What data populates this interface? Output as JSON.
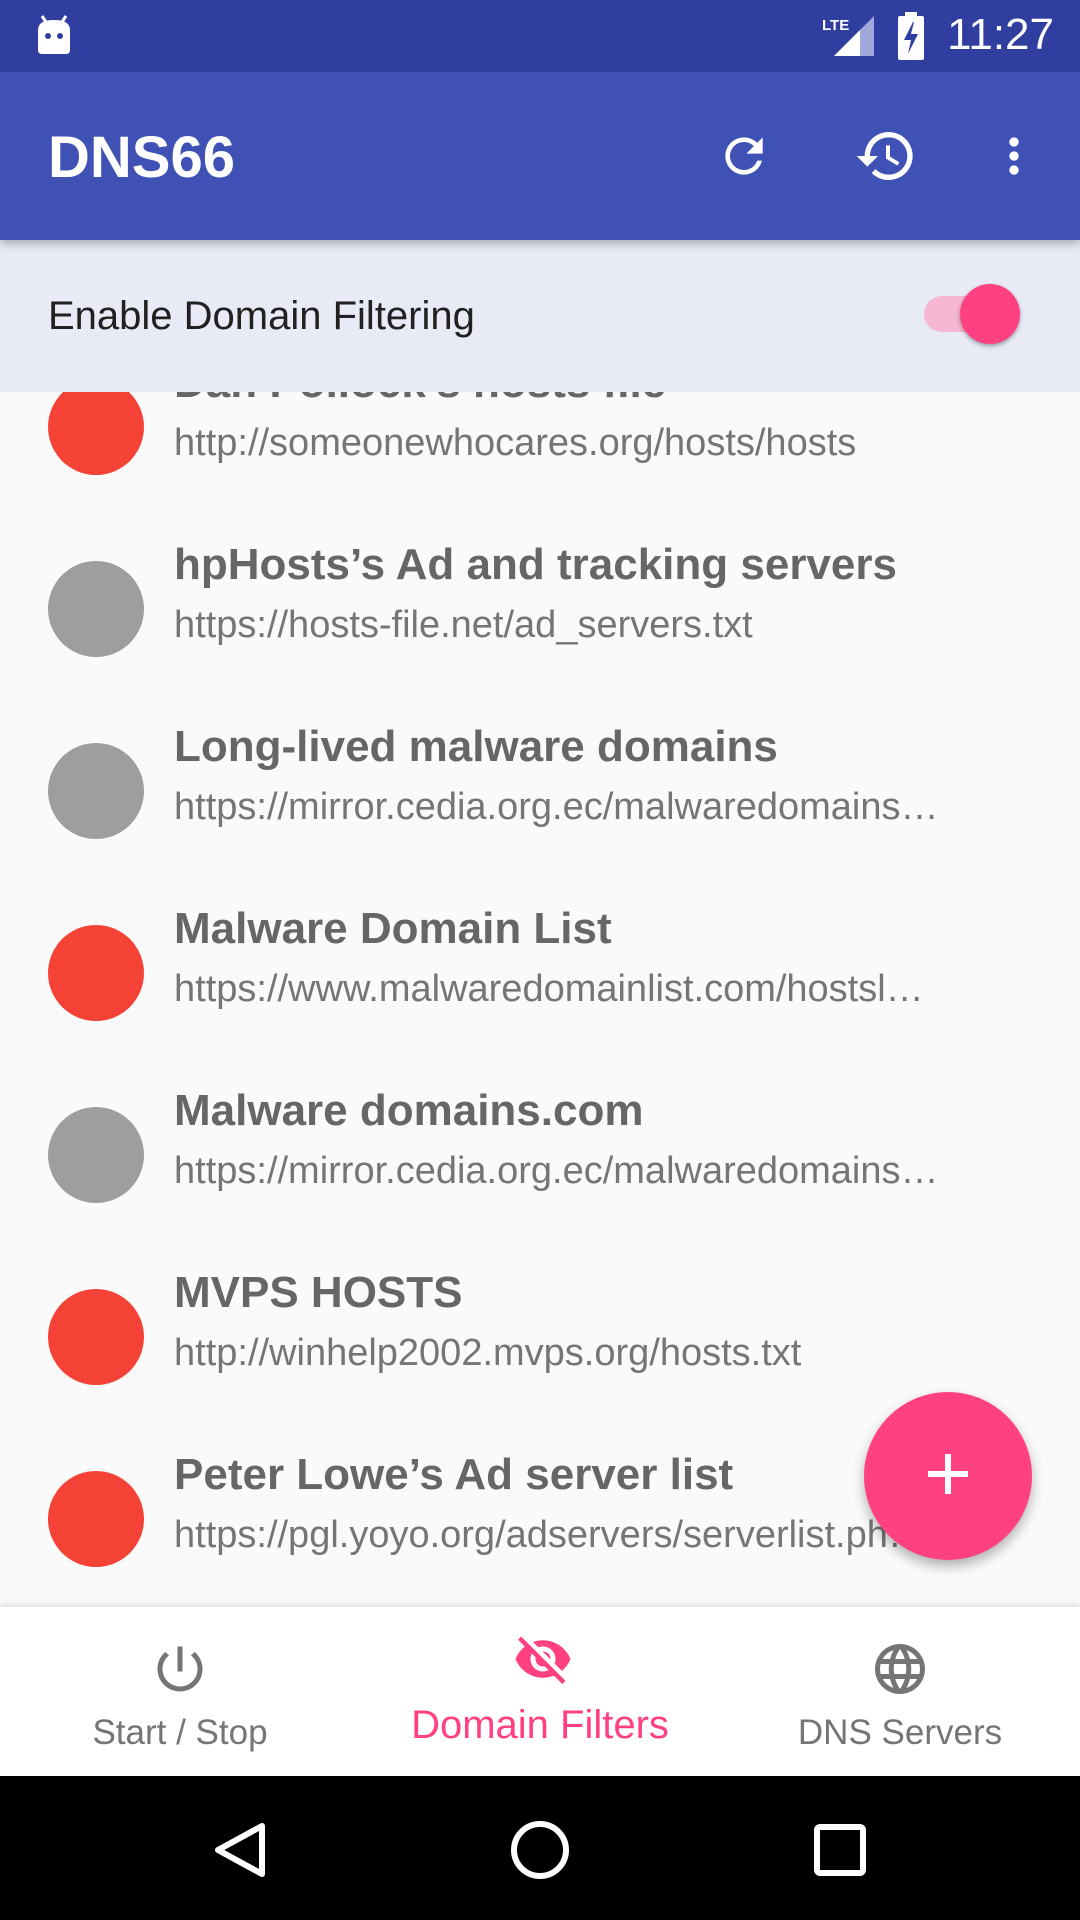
{
  "status_bar": {
    "time": "11:27",
    "network": "LTE"
  },
  "app_bar": {
    "title": "DNS66",
    "actions": [
      "refresh-icon",
      "history-icon",
      "more-vert-icon"
    ]
  },
  "filter_toggle": {
    "label": "Enable Domain Filtering",
    "enabled": true
  },
  "colors": {
    "primary": "#3f51b5",
    "primary_dark": "#303f9f",
    "accent": "#ff4081",
    "deny": "#f44336",
    "ignore": "#9e9e9e"
  },
  "host_lists": [
    {
      "name": "Dan Pollock's hosts file",
      "url": "http://someonewhocares.org/hosts/hosts",
      "state": "deny"
    },
    {
      "name": "hpHosts’s Ad and tracking servers",
      "url": "https://hosts-file.net/ad_servers.txt",
      "state": "ignore"
    },
    {
      "name": "Long-lived malware domains",
      "url": "https://mirror.cedia.org.ec/malwaredomains…",
      "state": "ignore"
    },
    {
      "name": "Malware Domain List",
      "url": "https://www.malwaredomainlist.com/hostsl…",
      "state": "deny"
    },
    {
      "name": "Malware domains.com",
      "url": "https://mirror.cedia.org.ec/malwaredomains…",
      "state": "ignore"
    },
    {
      "name": "MVPS HOSTS",
      "url": "http://winhelp2002.mvps.org/hosts.txt",
      "state": "deny"
    },
    {
      "name": "Peter Lowe’s Ad server list",
      "url": "https://pgl.yoyo.org/adservers/serverlist.ph…",
      "state": "deny"
    }
  ],
  "fab": {
    "icon": "add-icon"
  },
  "bottom_nav": {
    "items": [
      {
        "label": "Start / Stop",
        "icon": "power-icon",
        "active": false
      },
      {
        "label": "Domain Filters",
        "icon": "visibility-off-icon",
        "active": true
      },
      {
        "label": "DNS Servers",
        "icon": "globe-icon",
        "active": false
      }
    ]
  },
  "system_nav": [
    "back-icon",
    "home-icon",
    "recents-icon"
  ]
}
